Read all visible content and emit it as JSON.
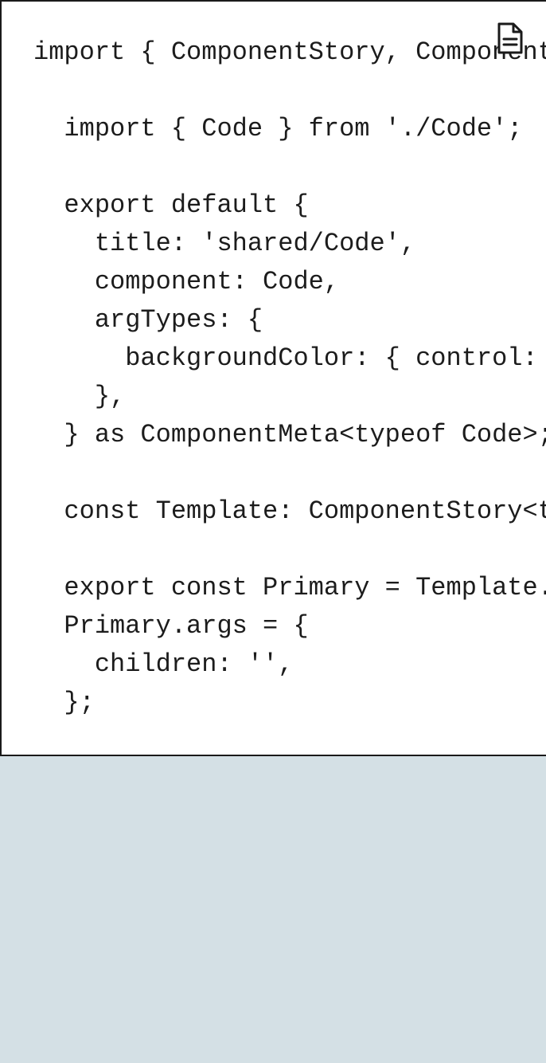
{
  "code_block": {
    "lines": [
      "import { ComponentStory, ComponentMeta } from '@storybook/react';",
      "",
      "  import { Code } from './Code';",
      "",
      "  export default {",
      "    title: 'shared/Code',",
      "    component: Code,",
      "    argTypes: {",
      "      backgroundColor: { control: 'color' },",
      "    },",
      "  } as ComponentMeta<typeof Code>;",
      "",
      "  const Template: ComponentStory<typeof Code> = (args) => <Code {...args} />;",
      "",
      "  export const Primary = Template.bind({});",
      "  Primary.args = {",
      "    children: '',",
      "  };"
    ],
    "copy_icon": "document-icon"
  },
  "colors": {
    "background": "#d4e0e5",
    "panel": "#ffffff",
    "border": "#1a1a1a",
    "text": "#1c1c1c"
  }
}
